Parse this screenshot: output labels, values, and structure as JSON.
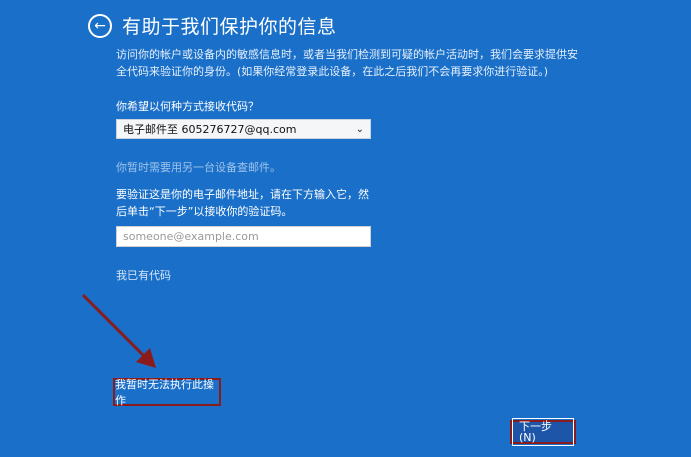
{
  "header": {
    "back_icon": "back-arrow-circle-icon",
    "title": "有助于我们保护你的信息"
  },
  "description": "访问你的帐户或设备内的敏感信息时，或者当我们检测到可疑的帐户活动时，我们会要求提供安全代码来验证你的身份。(如果你经常登录此设备，在此之后我们不会再要求你进行验证。)",
  "method": {
    "question": "你希望以何种方式接收代码？",
    "selected": "电子邮件至 605276727@qq.com"
  },
  "hint": "你暂时需要用另一台设备查邮件。",
  "verify": {
    "instruction": "要验证这是你的电子邮件地址，请在下方输入它，然后单击“下一步”以接收你的验证码。",
    "email_placeholder": "someone@example.com",
    "email_value": ""
  },
  "have_code": "我已有代码",
  "cant_do": "我暂时无法执行此操作",
  "next_button": "下一步(N)",
  "annotation": {
    "arrow_color": "#8b1a1a",
    "highlight_color": "#8b1a1a"
  }
}
